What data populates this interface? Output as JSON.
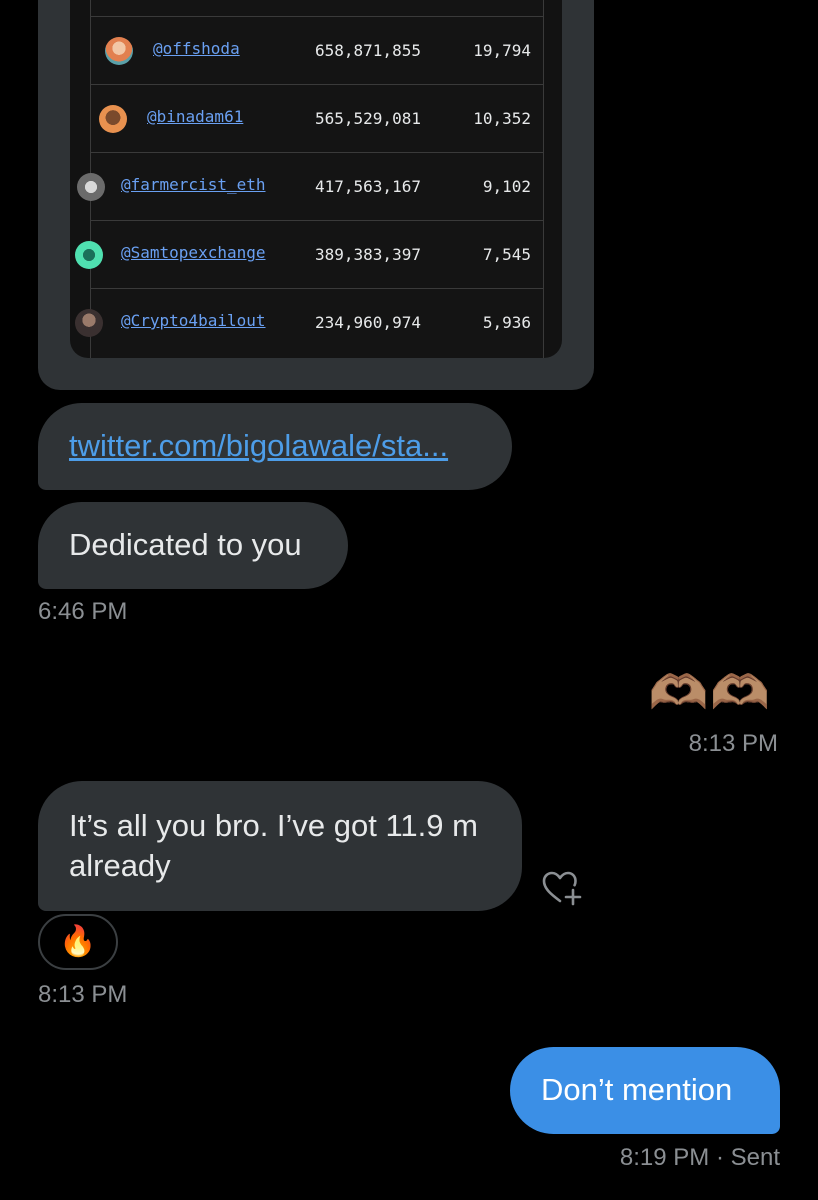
{
  "leaderboard": {
    "rows": [
      {
        "handle": "@offshoda",
        "points": "658,871,855",
        "count": "19,794"
      },
      {
        "handle": "@binadam61",
        "points": "565,529,081",
        "count": "10,352"
      },
      {
        "handle": "@farmercist_eth",
        "points": "417,563,167",
        "count": "9,102"
      },
      {
        "handle": "@Samtopexchange",
        "points": "389,383,397",
        "count": "7,545"
      },
      {
        "handle": "@Crypto4bailout",
        "points": "234,960,974",
        "count": "5,936"
      }
    ]
  },
  "messages": {
    "link": {
      "text": "twitter.com/bigolawale/sta..."
    },
    "dedicated": {
      "text": "Dedicated to you"
    },
    "time1": "6:46 PM",
    "emoji": {
      "text": "🫶🏽🫶🏽"
    },
    "time2": "8:13 PM",
    "allyou": {
      "text": "It’s all you bro. I’ve got 11.9 m already"
    },
    "reaction": "🔥",
    "time3": "8:13 PM",
    "dont_mention": {
      "text": "Don’t mention"
    },
    "time4": "8:19 PM",
    "status": "· Sent"
  },
  "icons": {
    "add_reaction": "heart-plus-icon"
  },
  "colors": {
    "background": "#000000",
    "received_bubble": "#2f3336",
    "sent_bubble": "#3b8fe6",
    "link": "#4d9de8",
    "muted": "#8b8f93"
  }
}
